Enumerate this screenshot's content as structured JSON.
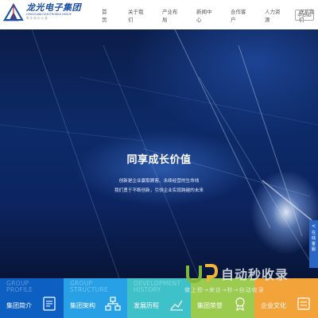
{
  "header": {
    "logo_cn": "龙光电子集团",
    "logo_en": "LONGGUANG ELECTRONICS GROUP",
    "logo_slogan": "同享成长价值",
    "logo_mark_text": "LONGGUANG",
    "nav": [
      "首页",
      "关于我们",
      "产业布局",
      "新闻中心",
      "合作客户",
      "人力资源",
      "联系我们"
    ],
    "lang": "中|ENG"
  },
  "hero": {
    "title": "同享成长价值",
    "line1": "创新是企业赢取顾客、永续经营的生命线",
    "line2": "我们勇于不断创新，引领企业实现跨越的未来"
  },
  "side_tab": {
    "arrow": "<",
    "label": [
      "在",
      "线",
      "客",
      "服"
    ]
  },
  "tiles": [
    {
      "en": "GROUP PROFILE",
      "cn": "集团简介",
      "color": "#0d5fc2",
      "icon": "document-icon"
    },
    {
      "en": "GROUP STRUCTURE",
      "cn": "集团架构",
      "color": "#27a0e6",
      "icon": "org-chart-icon"
    },
    {
      "en": "DEVELOPMENT HISTORY",
      "cn": "发展历程",
      "color": "#3ec1c9",
      "icon": "history-icon"
    },
    {
      "en": "",
      "cn": "集团荣誉",
      "color": "#9ccc4f",
      "icon": "honor-icon"
    },
    {
      "en": "",
      "cn": "企业文化",
      "color": "#f2a43a",
      "icon": "culture-icon"
    }
  ],
  "watermark": {
    "title": "自动秒收录",
    "sub": "做上榜→来访→秒→自动收录"
  }
}
